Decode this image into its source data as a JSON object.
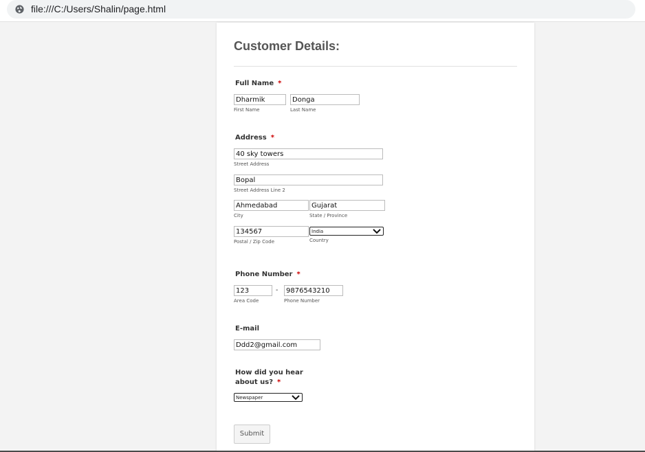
{
  "browser": {
    "url": "file:///C:/Users/Shalin/page.html"
  },
  "form": {
    "title": "Customer Details:",
    "required_marker": "*",
    "full_name": {
      "label": "Full Name",
      "first_value": "Dharmik",
      "first_sublabel": "First Name",
      "last_value": "Donga",
      "last_sublabel": "Last Name"
    },
    "address": {
      "label": "Address",
      "street_value": "40 sky towers",
      "street_sublabel": "Street Address",
      "street2_value": "Bopal",
      "street2_sublabel": "Street Address Line 2",
      "city_value": "Ahmedabad",
      "city_sublabel": "City",
      "state_value": "Gujarat",
      "state_sublabel": "State / Province",
      "zip_value": "134567",
      "zip_sublabel": "Postal / Zip Code",
      "country_value": "India",
      "country_sublabel": "Country"
    },
    "phone": {
      "label": "Phone Number",
      "area_value": "123",
      "area_sublabel": "Area Code",
      "separator": "-",
      "number_value": "9876543210",
      "number_sublabel": "Phone Number"
    },
    "email": {
      "label": "E-mail",
      "value": "Ddd2@gmail.com"
    },
    "hear": {
      "label_line1": "How did you hear",
      "label_line2": "about us?",
      "value": "Newspaper"
    },
    "submit_label": "Submit"
  }
}
